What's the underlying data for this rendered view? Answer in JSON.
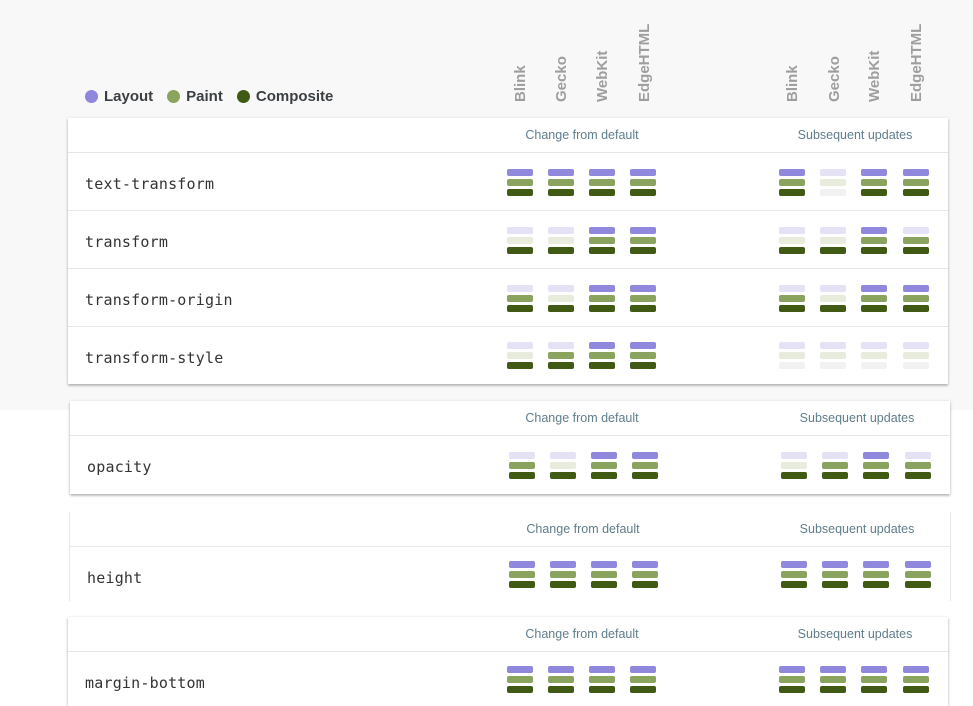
{
  "legend": [
    {
      "label": "Layout",
      "color": "#8f86dd"
    },
    {
      "label": "Paint",
      "color": "#8aa35e"
    },
    {
      "label": "Composite",
      "color": "#3f5a15"
    }
  ],
  "browsers": [
    "Blink",
    "Gecko",
    "WebKit",
    "EdgeHTML"
  ],
  "colors": {
    "layout_on": "#9088dc",
    "layout_off": "#e5e2f6",
    "paint_on": "#8aa35e",
    "paint_off": "#e8ecdc",
    "composite_on": "#405a14",
    "composite_off": "#f2f2f2"
  },
  "column_headers": {
    "change": "Change from default",
    "subsequent": "Subsequent updates"
  },
  "cards": [
    {
      "rows": [
        {
          "property": "text-transform",
          "change": [
            [
              1,
              1,
              1
            ],
            [
              1,
              1,
              1
            ],
            [
              1,
              1,
              1
            ],
            [
              1,
              1,
              1
            ]
          ],
          "subsequent": [
            [
              1,
              1,
              1
            ],
            [
              0,
              0,
              0
            ],
            [
              1,
              1,
              1
            ],
            [
              1,
              1,
              1
            ]
          ]
        },
        {
          "property": "transform",
          "change": [
            [
              0,
              0,
              1
            ],
            [
              0,
              0,
              1
            ],
            [
              1,
              1,
              1
            ],
            [
              1,
              1,
              1
            ]
          ],
          "subsequent": [
            [
              0,
              0,
              1
            ],
            [
              0,
              0,
              1
            ],
            [
              1,
              1,
              1
            ],
            [
              0,
              1,
              1
            ]
          ]
        },
        {
          "property": "transform-origin",
          "change": [
            [
              0,
              1,
              1
            ],
            [
              0,
              0,
              1
            ],
            [
              1,
              1,
              1
            ],
            [
              1,
              1,
              1
            ]
          ],
          "subsequent": [
            [
              0,
              1,
              1
            ],
            [
              0,
              0,
              1
            ],
            [
              1,
              1,
              1
            ],
            [
              1,
              1,
              1
            ]
          ]
        },
        {
          "property": "transform-style",
          "change": [
            [
              0,
              0,
              1
            ],
            [
              0,
              1,
              1
            ],
            [
              1,
              1,
              1
            ],
            [
              1,
              1,
              1
            ]
          ],
          "subsequent": [
            [
              0,
              0,
              0
            ],
            [
              0,
              0,
              0
            ],
            [
              0,
              0,
              0
            ],
            [
              0,
              0,
              0
            ]
          ]
        }
      ]
    },
    {
      "rows": [
        {
          "property": "opacity",
          "change": [
            [
              0,
              1,
              1
            ],
            [
              0,
              0,
              1
            ],
            [
              1,
              1,
              1
            ],
            [
              1,
              1,
              1
            ]
          ],
          "subsequent": [
            [
              0,
              0,
              1
            ],
            [
              0,
              1,
              1
            ],
            [
              1,
              1,
              1
            ],
            [
              0,
              1,
              1
            ]
          ]
        }
      ]
    },
    {
      "rows": [
        {
          "property": "height",
          "change": [
            [
              1,
              1,
              1
            ],
            [
              1,
              1,
              1
            ],
            [
              1,
              1,
              1
            ],
            [
              1,
              1,
              1
            ]
          ],
          "subsequent": [
            [
              1,
              1,
              1
            ],
            [
              1,
              1,
              1
            ],
            [
              1,
              1,
              1
            ],
            [
              1,
              1,
              1
            ]
          ]
        }
      ]
    },
    {
      "rows": [
        {
          "property": "margin-bottom",
          "change": [
            [
              1,
              1,
              1
            ],
            [
              1,
              1,
              1
            ],
            [
              1,
              1,
              1
            ],
            [
              1,
              1,
              1
            ]
          ],
          "subsequent": [
            [
              1,
              1,
              1
            ],
            [
              1,
              1,
              1
            ],
            [
              1,
              1,
              1
            ],
            [
              1,
              1,
              1
            ]
          ]
        }
      ]
    }
  ]
}
